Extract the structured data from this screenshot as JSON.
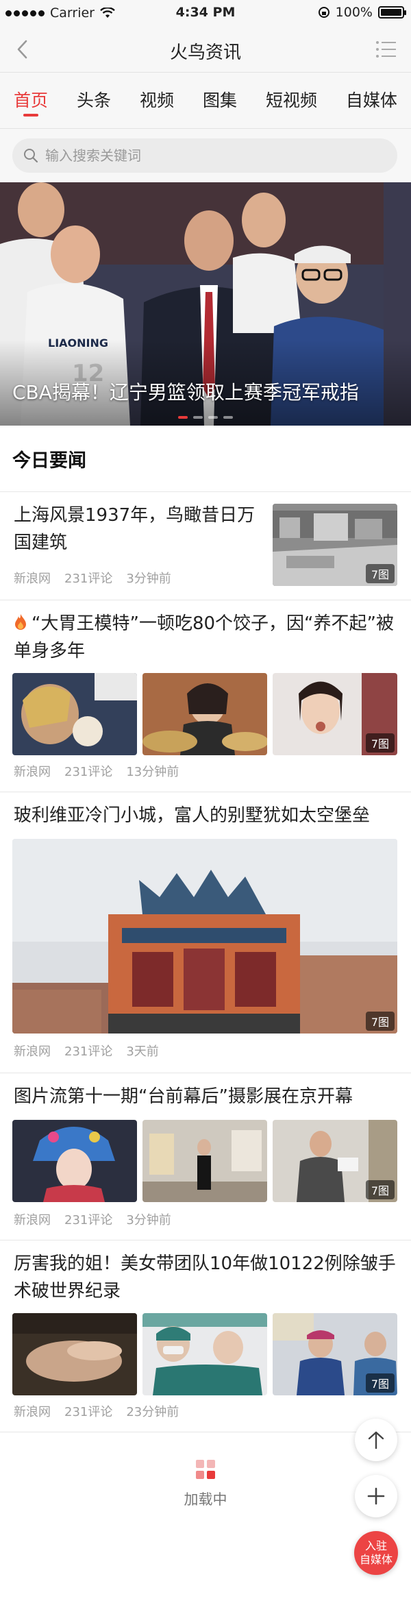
{
  "status_bar": {
    "carrier": "Carrier",
    "time": "4:34 PM",
    "battery_label": "100%",
    "battery_level": 1.0
  },
  "nav": {
    "title": "火鸟资讯",
    "back_icon": "chevron-left-icon",
    "menu_icon": "list-menu-icon"
  },
  "tabs": [
    {
      "label": "首页",
      "active": true
    },
    {
      "label": "头条",
      "active": false
    },
    {
      "label": "视频",
      "active": false
    },
    {
      "label": "图集",
      "active": false
    },
    {
      "label": "短视频",
      "active": false
    },
    {
      "label": "自媒体",
      "active": false
    }
  ],
  "search": {
    "placeholder": "输入搜索关键词"
  },
  "hero": {
    "caption": "CBA揭幕！辽宁男篮领取上赛季冠军戒指",
    "slide_count": 4,
    "active_slide": 1
  },
  "section": {
    "title": "今日要闻"
  },
  "articles": [
    {
      "title": "上海风景1937年，鸟瞰昔日万国建筑",
      "source": "新浪网",
      "comments": "231评论",
      "time": "3分钟前",
      "badge": "7图"
    },
    {
      "title": "“大胃王模特”一顿吃80个饺子，因“养不起”被单身多年",
      "hot": true,
      "source": "新浪网",
      "comments": "231评论",
      "time": "13分钟前",
      "badge": "7图"
    },
    {
      "title": "玻利维亚冷门小城，富人的别墅犹如太空堡垒",
      "source": "新浪网",
      "comments": "231评论",
      "time": "3天前",
      "badge": "7图"
    },
    {
      "title": "图片流第十一期“台前幕后”摄影展在京开幕",
      "source": "新浪网",
      "comments": "231评论",
      "time": "3分钟前",
      "badge": "7图"
    },
    {
      "title": "厉害我的姐！美女带团队10年做10122例除皱手术破世界纪录",
      "source": "新浪网",
      "comments": "231评论",
      "time": "23分钟前",
      "badge": "7图"
    }
  ],
  "float_buttons": {
    "top_icon": "arrow-up-icon",
    "add_icon": "plus-icon",
    "join_line1": "入驻",
    "join_line2": "自媒体"
  },
  "loading": {
    "text": "加载中"
  },
  "colors": {
    "accent": "#e83a3a",
    "meta": "#a0a0a0",
    "bar_bg": "#f7f7f7"
  }
}
